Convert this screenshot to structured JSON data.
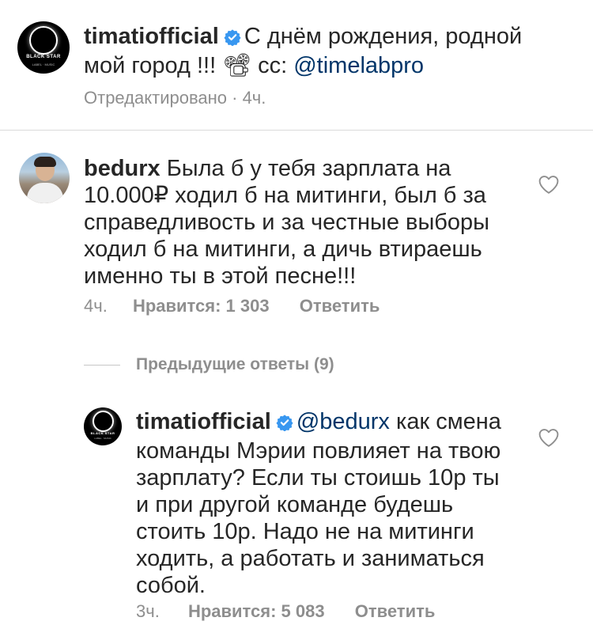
{
  "post": {
    "avatar_brand": "BLACK STAR",
    "avatar_sub": "LABEL · MUSIC",
    "username": "timatiofficial",
    "caption": "С днём рождения, родной мой город !!! 📽 сс: ",
    "caption_mention": "@timelabpro",
    "meta": "Отредактировано · 4ч."
  },
  "comment": {
    "username": "bedurx",
    "text": "Была б у тебя зарплата на 10.000₽ ходил б на митинги, был б за справедливость и за честные выборы ходил б на митинги, а дичь втираешь именно ты в этой песне!!!",
    "time": "4ч.",
    "likes": "Нравится: 1 303",
    "reply_label": "Ответить"
  },
  "previous_replies": "Предыдущие ответы (9)",
  "reply": {
    "avatar_brand": "BLACK STAR",
    "avatar_sub": "LABEL · MUSIC",
    "username": "timatiofficial",
    "mention": "@bedurx",
    "text": " как смена команды Мэрии повлияет на твою зарплату? Если ты стоишь 10р ты и при другой команде будешь стоить 10р. Надо не на митинги ходить, а работать и заниматься собой.",
    "time": "3ч.",
    "likes": "Нравится: 5 083",
    "reply_label": "Ответить"
  },
  "colors": {
    "text": "#262626",
    "secondary": "#8e8e8e",
    "mention": "#003569",
    "verified": "#3897f0",
    "divider": "#dbdbdb"
  },
  "icons": [
    "verified-badge-icon",
    "heart-icon"
  ]
}
